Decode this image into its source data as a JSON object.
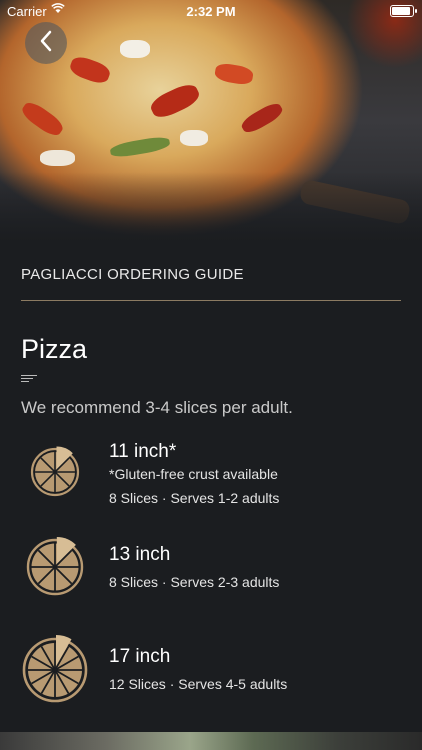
{
  "status_bar": {
    "carrier": "Carrier",
    "time": "2:32 PM"
  },
  "navigation": {
    "back_icon": "chevron-left-icon"
  },
  "header": {
    "guide_title": "PAGLIACCI ORDERING GUIDE"
  },
  "section": {
    "title": "Pizza",
    "recommendation": "We recommend 3-4 slices per adult."
  },
  "sizes": [
    {
      "name": "11 inch*",
      "note": "*Gluten-free crust available",
      "slices": "8 Slices · Serves 1-2 adults",
      "icon": "pizza-8-slice-icon",
      "slice_count": 8
    },
    {
      "name": "13 inch",
      "note": "",
      "slices": "8 Slices · Serves 2-3 adults",
      "icon": "pizza-8-slice-icon",
      "slice_count": 8
    },
    {
      "name": "17 inch",
      "note": "",
      "slices": "12 Slices · Serves 4-5 adults",
      "icon": "pizza-12-slice-icon",
      "slice_count": 12
    }
  ],
  "colors": {
    "background": "#1b1d20",
    "accent": "#b89a72",
    "crust": "#d7bd95"
  }
}
